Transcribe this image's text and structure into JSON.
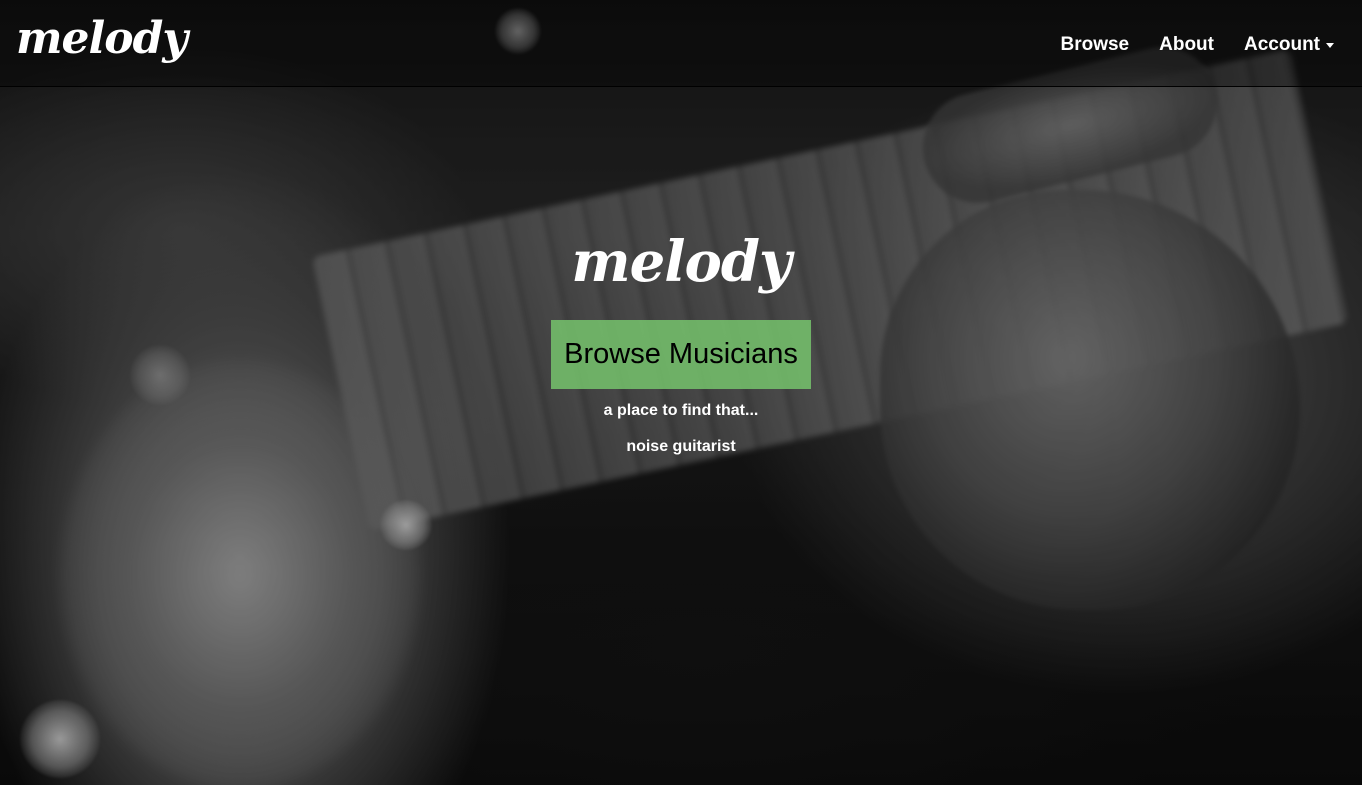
{
  "navbar": {
    "brand": "melody",
    "links": [
      {
        "label": "Browse"
      },
      {
        "label": "About"
      },
      {
        "label": "Account"
      }
    ]
  },
  "hero": {
    "logo": "melody",
    "cta_label": "Browse Musicians",
    "tagline": "a place to find that...",
    "rotating_text": "noise guitarist",
    "cta_color": "#78c86e"
  },
  "icons": {
    "account_dropdown": "caret-down-icon"
  }
}
